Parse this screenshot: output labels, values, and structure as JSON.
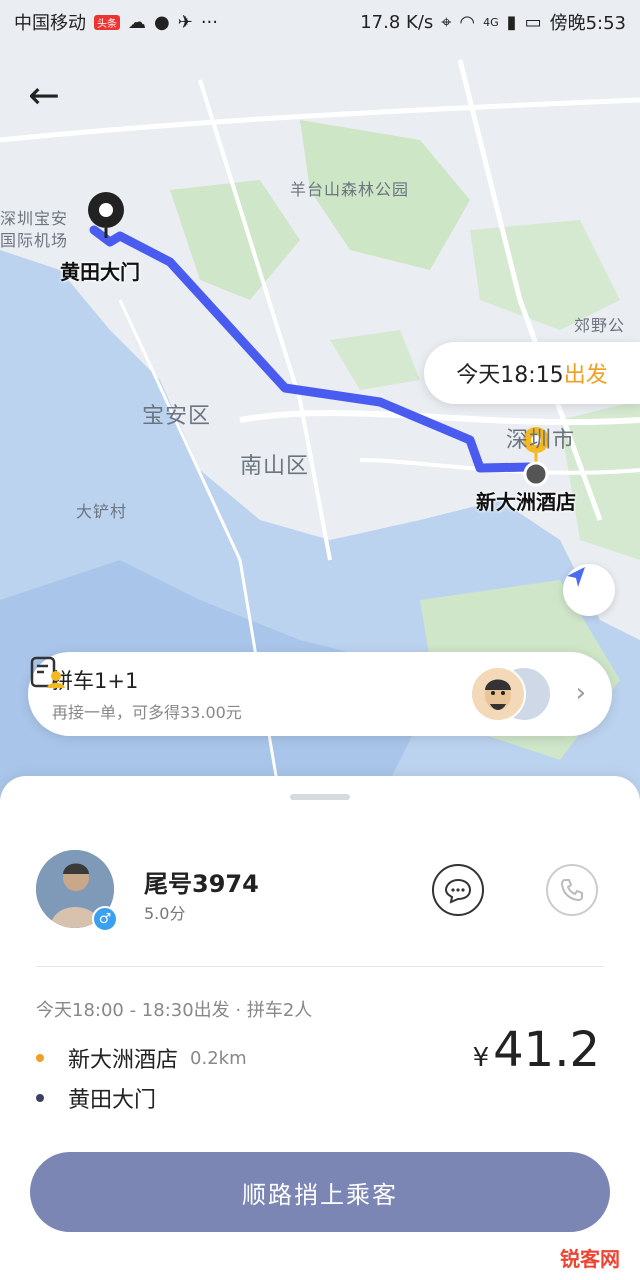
{
  "status_bar": {
    "carrier": "中国移动",
    "badge": "头条",
    "speed": "17.8 K/s",
    "network": "4G",
    "time": "傍晚5:53"
  },
  "map": {
    "origin_label": "黄田大门",
    "destination_label": "新大洲酒店",
    "place_names": {
      "airport": "深圳宝安国际机场",
      "park": "羊台山森林公园",
      "baoan": "宝安区",
      "nanshan": "南山区",
      "shenzhen": "深圳市",
      "dachan": "大铲村",
      "jiaoye": "郊野公园"
    },
    "depart_time": "今天18:15",
    "depart_word": "出发"
  },
  "carpool": {
    "title": "拼车1+1",
    "subtitle": "再接一单，可多得33.00元"
  },
  "passenger": {
    "name": "尾号3974",
    "rating": "5.0分",
    "gender_symbol": "♂"
  },
  "trip": {
    "info": "今天18:00 - 18:30出发 · 拼车2人",
    "pickup": "新大洲酒店",
    "pickup_distance": "0.2km",
    "dropoff": "黄田大门",
    "currency": "¥",
    "price": "41.2"
  },
  "cta_label": "顺路捎上乘客",
  "watermark": "锐客网",
  "colors": {
    "route": "#4a5cf0",
    "accent": "#f0a020",
    "cta": "#7b86b5"
  }
}
